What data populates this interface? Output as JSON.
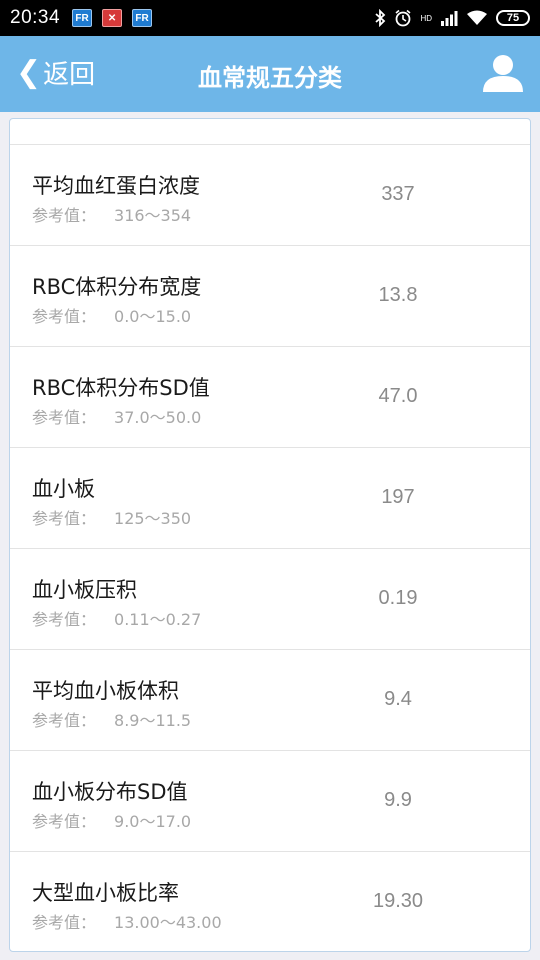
{
  "status_bar": {
    "time": "20:34",
    "left_icons": [
      "app-fr-icon",
      "app-red-icon",
      "app-fr-icon"
    ],
    "right_icons": [
      "bluetooth-icon",
      "alarm-icon",
      "signal-icon",
      "wifi-icon"
    ],
    "network_label": "HD",
    "battery": "75"
  },
  "header": {
    "back_label": "返回",
    "title": "血常规五分类",
    "user_icon": "user-icon"
  },
  "list": {
    "ref_label": "参考值：",
    "items": [
      {
        "name": "平均血红蛋白浓度",
        "range": "316～354",
        "value": "337"
      },
      {
        "name": "RBC体积分布宽度",
        "range": "0.0～15.0",
        "value": "13.8"
      },
      {
        "name": "RBC体积分布SD值",
        "range": "37.0～50.0",
        "value": "47.0"
      },
      {
        "name": "血小板",
        "range": "125～350",
        "value": "197"
      },
      {
        "name": "血小板压积",
        "range": "0.11～0.27",
        "value": "0.19"
      },
      {
        "name": "平均血小板体积",
        "range": "8.9～11.5",
        "value": "9.4"
      },
      {
        "name": "血小板分布SD值",
        "range": "9.0～17.0",
        "value": "9.9"
      },
      {
        "name": "大型血小板比率",
        "range": "13.00～43.00",
        "value": "19.30"
      }
    ]
  },
  "colors": {
    "header_bg": "#6eb6e8",
    "value_text": "#8a8a8a",
    "ref_text": "#a8a8a8"
  }
}
